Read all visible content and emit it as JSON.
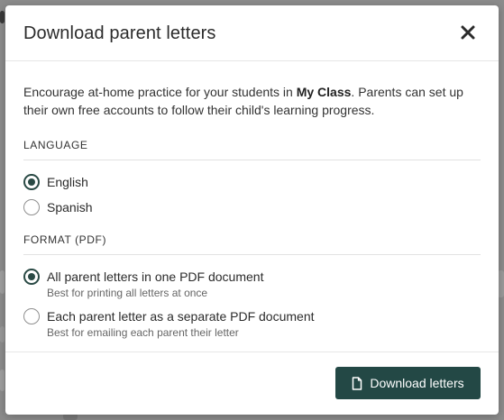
{
  "dialog": {
    "title": "Download parent letters",
    "close_icon": "close-icon"
  },
  "intro": {
    "prefix": "Encourage at-home practice for your students in ",
    "class_name": "My Class",
    "suffix": ". Parents can set up their own free accounts to follow their child's learning progress."
  },
  "language": {
    "label": "LANGUAGE",
    "selected": "English",
    "options": [
      {
        "label": "English",
        "checked": true
      },
      {
        "label": "Spanish",
        "checked": false
      }
    ]
  },
  "format": {
    "label": "FORMAT (PDF)",
    "options": [
      {
        "label": "All parent letters in one PDF document",
        "hint": "Best for printing all letters at once",
        "checked": true
      },
      {
        "label": "Each parent letter as a separate PDF document",
        "hint": "Best for emailing each parent their letter",
        "checked": false
      }
    ]
  },
  "footer": {
    "download_label": "Download letters",
    "download_icon": "document-icon"
  },
  "colors": {
    "accent": "#234845",
    "overlay": "#8c8c8c"
  }
}
